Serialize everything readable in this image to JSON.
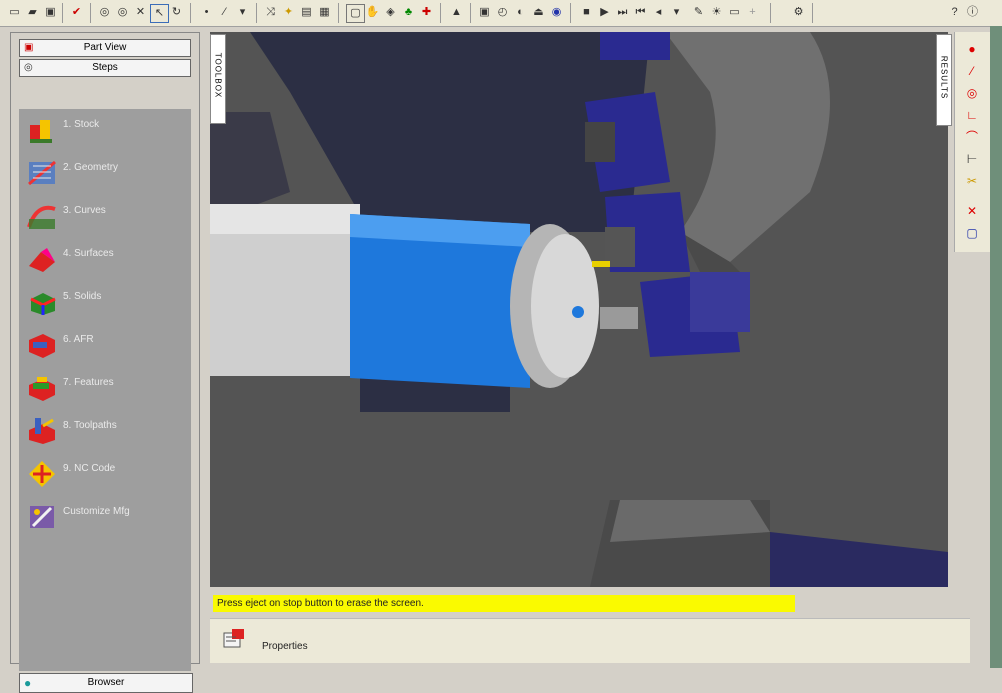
{
  "left_panel": {
    "tabs": [
      "Part View",
      "Steps"
    ],
    "steps": [
      {
        "label": "1. Stock",
        "icon": "stock-icon"
      },
      {
        "label": "2. Geometry",
        "icon": "geometry-icon"
      },
      {
        "label": "3. Curves",
        "icon": "curves-icon"
      },
      {
        "label": "4. Surfaces",
        "icon": "surfaces-icon"
      },
      {
        "label": "5. Solids",
        "icon": "solids-icon"
      },
      {
        "label": "6. AFR",
        "icon": "afr-icon"
      },
      {
        "label": "7. Features",
        "icon": "features-icon"
      },
      {
        "label": "8. Toolpaths",
        "icon": "toolpaths-icon"
      },
      {
        "label": "9. NC Code",
        "icon": "nc-code-icon"
      },
      {
        "label": "Customize Mfg",
        "icon": "customize-mfg-icon"
      }
    ],
    "browser_tab": "Browser"
  },
  "toolbox_tab": "TOOLBOX",
  "results_tab": "RESULTS",
  "message": "Press eject on stop button to erase the screen.",
  "properties": {
    "label": "Properties"
  },
  "colors": {
    "toolbar": "#ece9d8",
    "panel": "#9e9e9e",
    "message": "#fafa00",
    "part": "#1e78dc",
    "fixture": "#2a2a90"
  }
}
